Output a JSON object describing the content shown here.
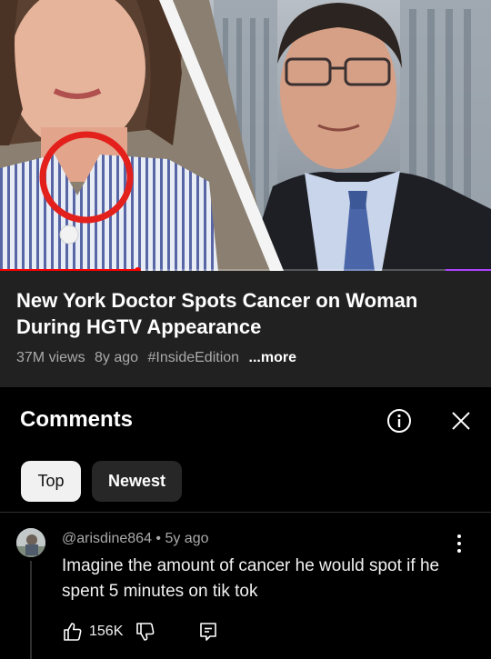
{
  "video": {
    "title": "New York Doctor Spots Cancer on Woman During HGTV Appearance",
    "views": "37M views",
    "age": "8y ago",
    "hashtag": "#InsideEdition",
    "more": "...more",
    "progress_fraction": 0.28
  },
  "comments": {
    "heading": "Comments",
    "info_icon": "info-icon",
    "close_icon": "close-icon",
    "sort_chips": [
      {
        "label": "Top",
        "selected": true
      },
      {
        "label": "Newest",
        "selected": false
      }
    ],
    "items": [
      {
        "author_line": "@arisdine864 • 5y ago",
        "text": "Imagine the amount of cancer he would spot if he spent 5 minutes on tik tok",
        "likes": "156K",
        "icons": [
          "thumbs-up-icon",
          "thumbs-down-icon",
          "reply-icon",
          "more-vert-icon"
        ]
      }
    ]
  },
  "colors": {
    "info_panel_bg": "#212121",
    "page_bg": "#000000",
    "chip_selected_bg": "#f1f1f1",
    "chip_bg": "#272727",
    "secondary_text": "#aaaaaa",
    "circle_highlight": "#e3201b",
    "progress_red": "#ff0000"
  }
}
